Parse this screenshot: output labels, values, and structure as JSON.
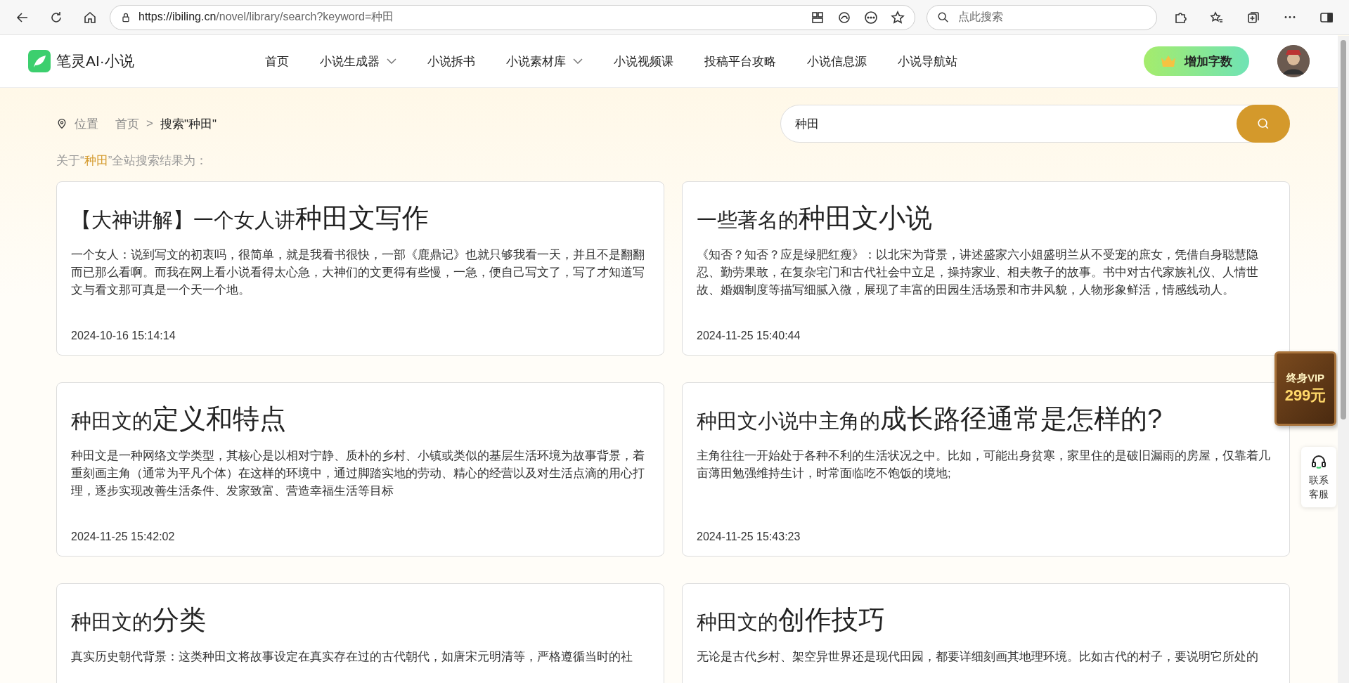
{
  "browser": {
    "url_host": "https://ibiling.cn",
    "url_path": "/novel/library/search?keyword=种田",
    "search_placeholder": "点此搜索"
  },
  "header": {
    "logo_text": "笔灵AI·小说",
    "nav": [
      {
        "label": "首页",
        "dropdown": false
      },
      {
        "label": "小说生成器",
        "dropdown": true
      },
      {
        "label": "小说拆书",
        "dropdown": false
      },
      {
        "label": "小说素材库",
        "dropdown": true
      },
      {
        "label": "小说视频课",
        "dropdown": false
      },
      {
        "label": "投稿平台攻略",
        "dropdown": false
      },
      {
        "label": "小说信息源",
        "dropdown": false
      },
      {
        "label": "小说导航站",
        "dropdown": false
      }
    ],
    "cta": "增加字数"
  },
  "breadcrumb": {
    "label": "位置",
    "items": [
      "首页",
      "搜索\"种田\""
    ],
    "separator": ">"
  },
  "search": {
    "value": "种田"
  },
  "result_note": {
    "prefix": "关于“",
    "keyword": "种田",
    "suffix": "”全站搜索结果为："
  },
  "results": [
    {
      "title_prefix": "【大神讲解】一个女人讲",
      "title_highlight": "种田文写作",
      "excerpt": "一个女人：说到写文的初衷吗，很简单，就是我看书很快，一部《鹿鼎记》也就只够我看一天，并且不是翻翻而已那么看啊。而我在网上看小说看得太心急，大神们的文更得有些慢，一急，便自己写文了，写了才知道写文与看文那可真是一个天一个地。",
      "date": "2024-10-16 15:14:14"
    },
    {
      "title_prefix": "一些著名的",
      "title_highlight": "种田文小说",
      "excerpt": "《知否？知否？应是绿肥红瘦》：以北宋为背景，讲述盛家六小姐盛明兰从不受宠的庶女，凭借自身聪慧隐忍、勤劳果敢，在复杂宅门和古代社会中立足，操持家业、相夫教子的故事。书中对古代家族礼仪、人情世故、婚姻制度等描写细腻入微，展现了丰富的田园生活场景和市井风貌，人物形象鲜活，情感线动人。",
      "date": "2024-11-25 15:40:44"
    },
    {
      "title_prefix": "种田文的",
      "title_highlight": "定义和特点",
      "excerpt": "种田文是一种网络文学类型，其核心是以相对宁静、质朴的乡村、小镇或类似的基层生活环境为故事背景，着重刻画主角（通常为平凡个体）在这样的环境中，通过脚踏实地的劳动、精心的经营以及对生活点滴的用心打理，逐步实现改善生活条件、发家致富、营造幸福生活等目标",
      "date": "2024-11-25 15:42:02"
    },
    {
      "title_prefix": "种田文小说中主角的",
      "title_highlight": "成长路径通常是怎样的?",
      "excerpt": "主角往往一开始处于各种不利的生活状况之中。比如，可能出身贫寒，家里住的是破旧漏雨的房屋，仅靠着几亩薄田勉强维持生计，时常面临吃不饱饭的境地;",
      "date": "2024-11-25 15:43:23"
    },
    {
      "title_prefix": "种田文的",
      "title_highlight": "分类",
      "excerpt": "真实历史朝代背景：这类种田文将故事设定在真实存在过的古代朝代，如唐宋元明清等，严格遵循当时的社"
    },
    {
      "title_prefix": "种田文的",
      "title_highlight": "创作技巧",
      "excerpt": "无论是古代乡村、架空异世界还是现代田园，都要详细刻画其地理环境。比如古代的村子，要说明它所处的"
    }
  ],
  "vip_badge": {
    "line1": "终身VIP",
    "line2": "299元"
  },
  "support": {
    "label": "联系客服"
  }
}
